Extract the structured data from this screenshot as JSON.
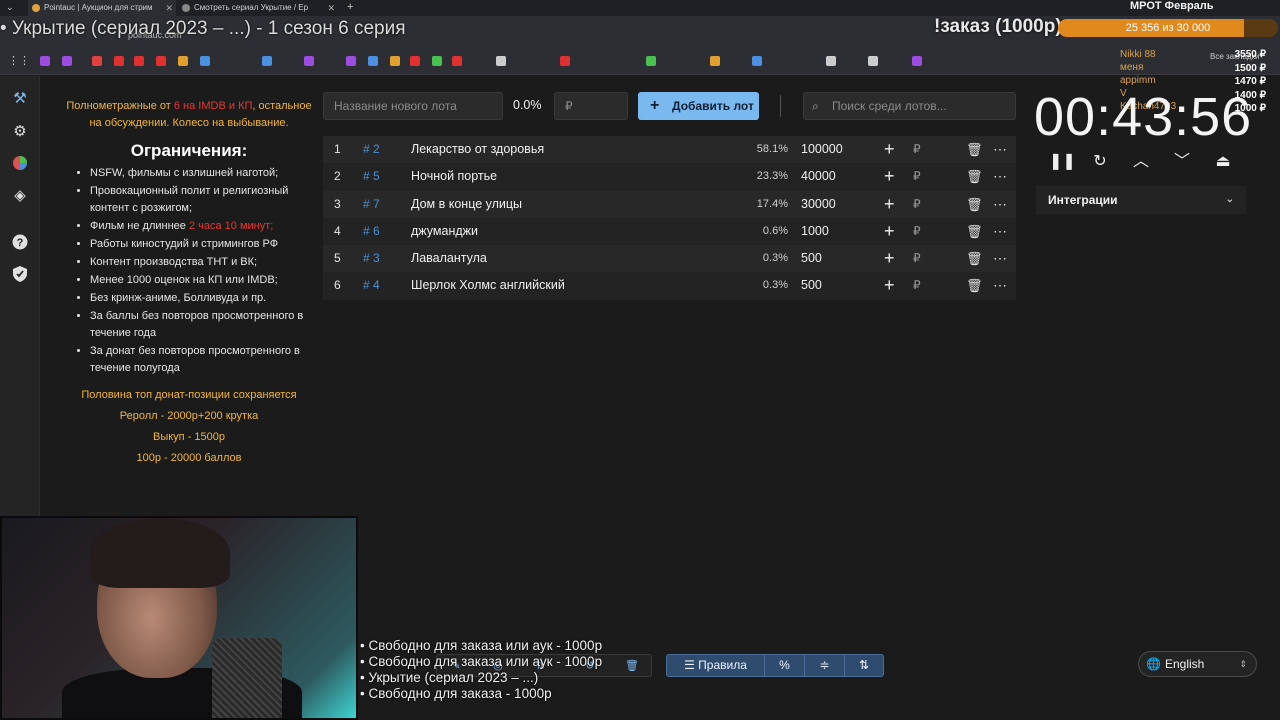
{
  "browser": {
    "tabs": [
      {
        "label": "Pointauc | Аукцион для стрим"
      },
      {
        "label": "Смотреть сериал Укрытие / Ер"
      }
    ],
    "url": "pointauc.com",
    "bookmarks_label": "Все закладки"
  },
  "overlay": {
    "title": "• Укрытие (сериал 2023 – ...) - 1 сезон 6 серия",
    "order_label": "!заказ (1000р)",
    "mrot_title": "МРОТ Февраль",
    "mrot_progress": "25 356 из 30 000",
    "mrot_fraction": 0.845,
    "donors": [
      {
        "name": "Nikki 88",
        "amount": "3550 ₽"
      },
      {
        "name": "меня",
        "amount": "1500 ₽"
      },
      {
        "name": "appimm",
        "amount": "1470 ₽"
      },
      {
        "name": "V",
        "amount": "1400 ₽"
      },
      {
        "name": "Kachan4703",
        "amount": "1000 ₽"
      }
    ]
  },
  "rail": {
    "icons": [
      "hammer-icon",
      "gear-icon",
      "pie-chart-icon",
      "layers-icon",
      "help-icon",
      "shield-icon"
    ]
  },
  "rules": {
    "intro_prefix": "Полнометражные от ",
    "intro_red": "6 на IMDB и КП",
    "intro_suffix": ", остальное на обсуждении. Колесо на выбывание.",
    "title": "Ограничения:",
    "items": [
      "NSFW, фильмы с излишней наготой;",
      "Провокационный полит и религиозный контент с розжигом;",
      "Фильм не длиннее ",
      "Работы киностудий и стримингов РФ",
      "Контент производства ТНТ и ВК;",
      "Менее 1000 оценок на КП или IMDB;",
      "Без кринж-аниме, Болливуда и пр.",
      "За баллы без повторов просмотренного в течение года",
      "За донат без повторов просмотренного в течение полугода"
    ],
    "duration_red": "2 часа 10 минут;",
    "footer": [
      "Половина топ донат-позиции сохраняется",
      "Реролл - 2000р+200 крутка",
      "Выкуп - 1500р",
      "100р - 20000 баллов"
    ]
  },
  "controls": {
    "lot_name_placeholder": "Название нового лота",
    "percent": "0.0%",
    "amount_placeholder": "₽",
    "add_button": "Добавить лот",
    "search_placeholder": "Поиск среди лотов..."
  },
  "lots": [
    {
      "num": "1",
      "id": "# 2",
      "name": "Лекарство от здоровья",
      "pct": "58.1%",
      "amount": "100000"
    },
    {
      "num": "2",
      "id": "# 5",
      "name": "Ночной портье",
      "pct": "23.3%",
      "amount": "40000"
    },
    {
      "num": "3",
      "id": "# 7",
      "name": "Дом в конце улицы",
      "pct": "17.4%",
      "amount": "30000"
    },
    {
      "num": "4",
      "id": "# 6",
      "name": "джуманджи",
      "pct": "0.6%",
      "amount": "1000"
    },
    {
      "num": "5",
      "id": "# 3",
      "name": "Лавалантула",
      "pct": "0.3%",
      "amount": "500"
    },
    {
      "num": "6",
      "id": "# 4",
      "name": "Шерлок Холмс английский",
      "pct": "0.3%",
      "amount": "500"
    }
  ],
  "currency": "₽",
  "timer": {
    "value": "00:43:56",
    "integrations_label": "Интеграции"
  },
  "queue": [
    "• Свободно для заказа или аук - 1000р",
    "• Свободно для заказа или аук - 1000р",
    "• Укрытие (сериал 2023 – ...)",
    "• Свободно для заказа - 1000р"
  ],
  "bottom_toolbar": {
    "rules_label": "Правила"
  },
  "language": "English"
}
